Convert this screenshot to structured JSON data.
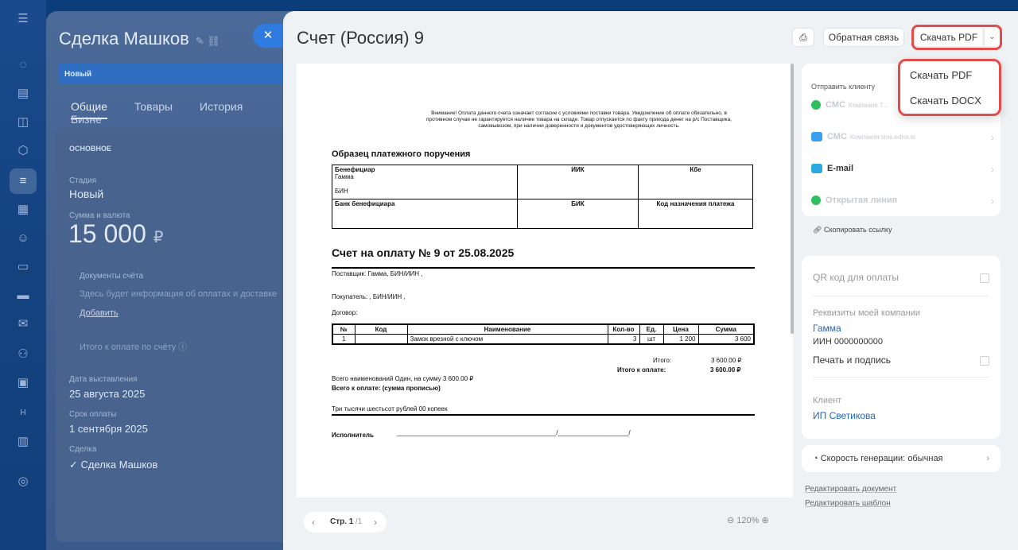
{
  "leftbar": {
    "icons": [
      "menu-icon",
      "chat-icon",
      "task-icon",
      "messenger-icon",
      "robot-icon",
      "funnel-icon",
      "calendar-icon",
      "bot-icon",
      "document-icon",
      "card-icon",
      "mail-icon",
      "contacts-icon",
      "screen-icon",
      "h-icon",
      "table-icon",
      "settings-icon"
    ]
  },
  "deal": {
    "title": "Сделка Машков",
    "stage_bar": "Новый",
    "tabs": [
      "Общие",
      "Товары",
      "История",
      "Бизне"
    ],
    "section": "ОСНОВНОЕ",
    "stage_label": "Стадия",
    "stage_value": "Новый",
    "sum_label": "Сумма и валюта",
    "sum_value": "15 000",
    "sum_currency": "₽",
    "docs_label": "Документы счёта",
    "docs_text": "Здесь будет информация об оплатах и доставке",
    "add_link": "Добавить",
    "total_text": "Итого к оплате по счёту",
    "issue_label": "Дата выставления",
    "issue_value": "25 августа 2025",
    "due_label": "Срок оплаты",
    "due_value": "1 сентября 2025",
    "deal_label": "Сделка",
    "deal_value": "Сделка Машков"
  },
  "panel": {
    "title": "Счет (Россия) 9",
    "feedback": "Обратная связь",
    "download_pdf": "Скачать PDF"
  },
  "document": {
    "warning": "Внимание! Оплата данного счета означает  согласие  с условиями  поставки товара. Уведомление об оплате обязательно,    в противном   случае не гарантируется наличие товара на складе. Товар отпускается по факту прихода денег на р/с Поставщика, самовывозом, при наличии доверенности и документов удостоверяющих личность.",
    "sample_title": "Образец платежного поручения",
    "beneficiary": "Бенефициар",
    "beneficiary_name": "Гамма",
    "bin": "БИН",
    "iik": "ИИК",
    "kbe": "Кбе",
    "bank": "Банк бенефициара",
    "bik": "БИК",
    "purpose_code": "Код назначения платежа",
    "invoice_title": "Счет на оплату № 9 от 25.08.2025",
    "supplier": "Поставщик: Гамма, БИН/ИИН ,",
    "buyer": "Покупатель: , БИН/ИИН ,",
    "contract": "Договор:",
    "headers": [
      "№",
      "Код",
      "Наименование",
      "Кол-во",
      "Ед.",
      "Цена",
      "Сумма"
    ],
    "row": [
      "1",
      "",
      "Замок врезной с ключом",
      "3",
      "шт",
      "1 200",
      "3 600"
    ],
    "total_label": "Итого:",
    "total_value": "3 600.00 ₽",
    "to_pay_label": "Итого к оплате:",
    "to_pay_value": "3 600.00 ₽",
    "items_summary": "Всего наименований Один, на сумму 3 600.00 ₽",
    "words_label": "Всего к оплате: (сумма прописью)",
    "words_value": "Три тысячи шестьсот рублей 00 копеек",
    "executor": "Исполнитель",
    "executor_line": "_____________________________________________/____________________/"
  },
  "pager": {
    "page": "Стр. 1",
    "total": "/1",
    "zoom": "120%"
  },
  "send": {
    "title": "Отправить клиенту",
    "items": [
      {
        "label": "СМС",
        "sub": "Компания Т...",
        "color": "#2fbf5f"
      },
      {
        "label": "СМС",
        "sub": "Компания sms.edna.io",
        "color": "#3b9df0"
      },
      {
        "label": "E-mail",
        "sub": "",
        "color": "#2aa8e0"
      },
      {
        "label": "Открытая линия",
        "sub": "",
        "color": "#2fbf5f"
      }
    ],
    "copy_link": "Скопировать ссылку"
  },
  "settings": {
    "qr": "QR код для оплаты",
    "company_label": "Реквизиты моей компании",
    "company_value": "Гамма",
    "inn": "ИИН 0000000000",
    "stamp": "Печать и подпись",
    "client_label": "Клиент",
    "client_value": "ИП Светикова",
    "speed_label": "Скорость генерации:",
    "speed_value": "обычная",
    "edit_doc": "Редактировать документ",
    "edit_tpl": "Редактировать шаблон"
  },
  "dropdown": {
    "items": [
      "Скачать PDF",
      "Скачать DOCX"
    ]
  },
  "colors": {
    "accent": "#2f7be0",
    "highlight": "#e44b4b",
    "link": "#1f65c4"
  }
}
